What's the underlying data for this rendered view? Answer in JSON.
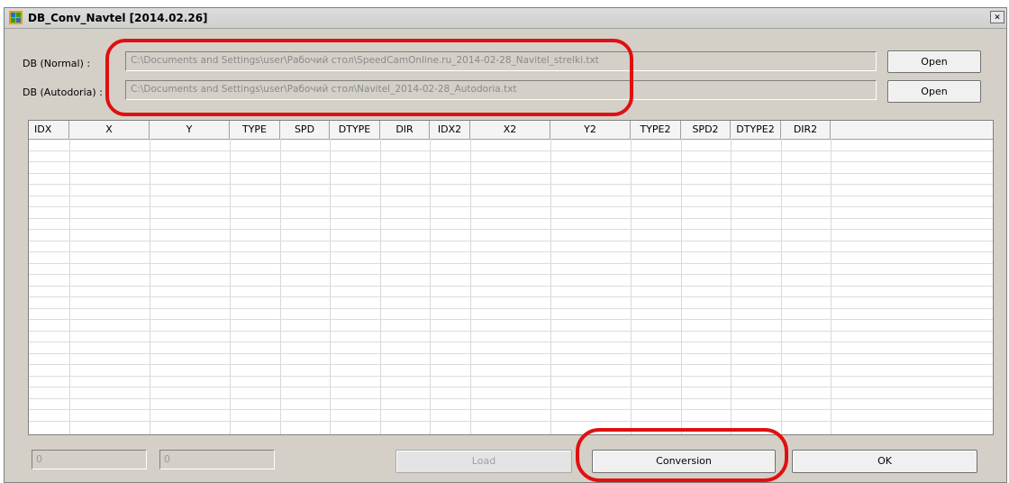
{
  "window": {
    "title": "DB_Conv_Navtel [2014.02.26]",
    "close_glyph": "×"
  },
  "db_normal": {
    "label": "DB (Normal) :",
    "path": "C:\\Documents and Settings\\user\\Рабочий стол\\SpeedCamOnline.ru_2014-02-28_Navitel_strelki.txt",
    "button": "Open"
  },
  "db_autodoria": {
    "label": "DB (Autodoria) :",
    "path": "C:\\Documents and Settings\\user\\Рабочий стол\\Navitel_2014-02-28_Autodoria.txt",
    "button": "Open"
  },
  "grid": {
    "columns": [
      "IDX",
      "X",
      "Y",
      "TYPE",
      "SPD",
      "DTYPE",
      "DIR",
      "IDX2",
      "X2",
      "Y2",
      "TYPE2",
      "SPD2",
      "DTYPE2",
      "DIR2"
    ]
  },
  "footer": {
    "count1": "0",
    "count2": "0",
    "load_button": "Load",
    "conversion_button": "Conversion",
    "ok_button": "OK"
  },
  "colors": {
    "annotation": "#e01010",
    "window_bg": "#d4d0c8"
  }
}
